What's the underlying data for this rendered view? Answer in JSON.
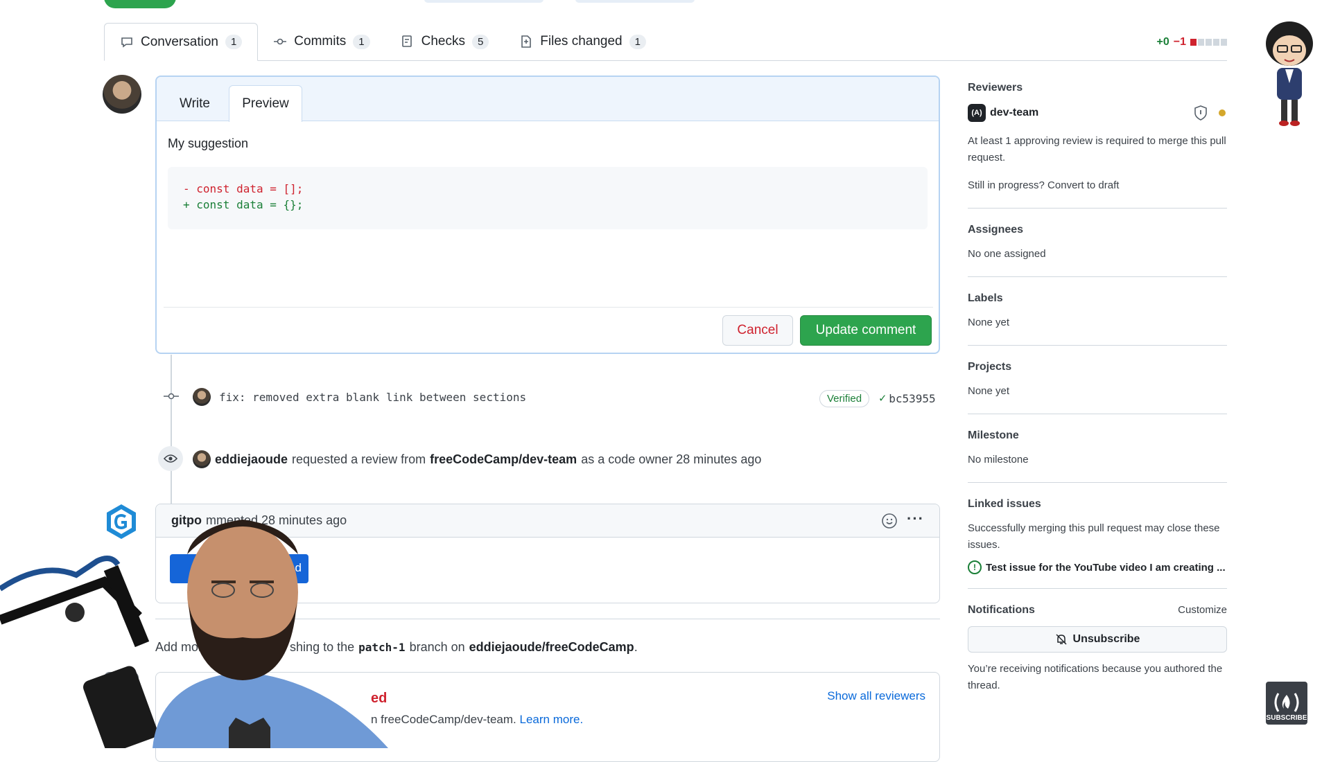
{
  "tabs": [
    {
      "label": "Conversation",
      "count": "1",
      "icon": "comment-icon"
    },
    {
      "label": "Commits",
      "count": "1",
      "icon": "commit-icon"
    },
    {
      "label": "Checks",
      "count": "5",
      "icon": "checklist-icon"
    },
    {
      "label": "Files changed",
      "count": "1",
      "icon": "file-diff-icon"
    }
  ],
  "diffstat": {
    "added": "+0",
    "removed": "−1"
  },
  "editor": {
    "write_tab": "Write",
    "preview_tab": "Preview",
    "suggestion_text": "My suggestion",
    "code_removed": "- const data = [];",
    "code_added": "+ const data = {};",
    "cancel_label": "Cancel",
    "update_label": "Update comment"
  },
  "commit": {
    "message": "fix: removed extra blank link between sections",
    "verified": "Verified",
    "sha": "bc53955"
  },
  "review_event": {
    "user": "eddiejaoude",
    "text1": "requested a review from",
    "team": "freeCodeCamp/dev-team",
    "text2": "as a code owner 28 minutes ago"
  },
  "gitpod_comment": {
    "author": "gitpo",
    "text": "mmented 28 minutes ago",
    "button_fragment": "d"
  },
  "merge_hint": {
    "prefix": "Add more",
    "middle": "shing to the",
    "branch": "patch-1",
    "mid2": "branch on",
    "repo": "eddiejaoude/freeCodeCamp",
    "suffix": "."
  },
  "review_required": {
    "title_fragment": "ed",
    "text": "n freeCodeCamp/dev-team.",
    "learn_more": "Learn more.",
    "show_all": "Show all reviewers"
  },
  "sidebar": {
    "reviewers_heading": "Reviewers",
    "reviewer_name": "dev-team",
    "reviewer_note": "At least 1 approving review is required to merge this pull request.",
    "draft_note": "Still in progress? Convert to draft",
    "assignees_heading": "Assignees",
    "assignees_value": "No one assigned",
    "labels_heading": "Labels",
    "labels_value": "None yet",
    "projects_heading": "Projects",
    "projects_value": "None yet",
    "milestone_heading": "Milestone",
    "milestone_value": "No milestone",
    "linked_heading": "Linked issues",
    "linked_note": "Successfully merging this pull request may close these issues.",
    "linked_issue": "Test issue for the YouTube video I am creating ...",
    "notifications_heading": "Notifications",
    "customize": "Customize",
    "unsubscribe": "Unsubscribe",
    "notif_note": "You’re receiving notifications because you authored the thread."
  },
  "subscribe_label": "SUBSCRIBE",
  "colors": {
    "green": "#2da44e",
    "red": "#cf222e",
    "blue": "#0969da",
    "gitpod_blue": "#1565d8"
  }
}
